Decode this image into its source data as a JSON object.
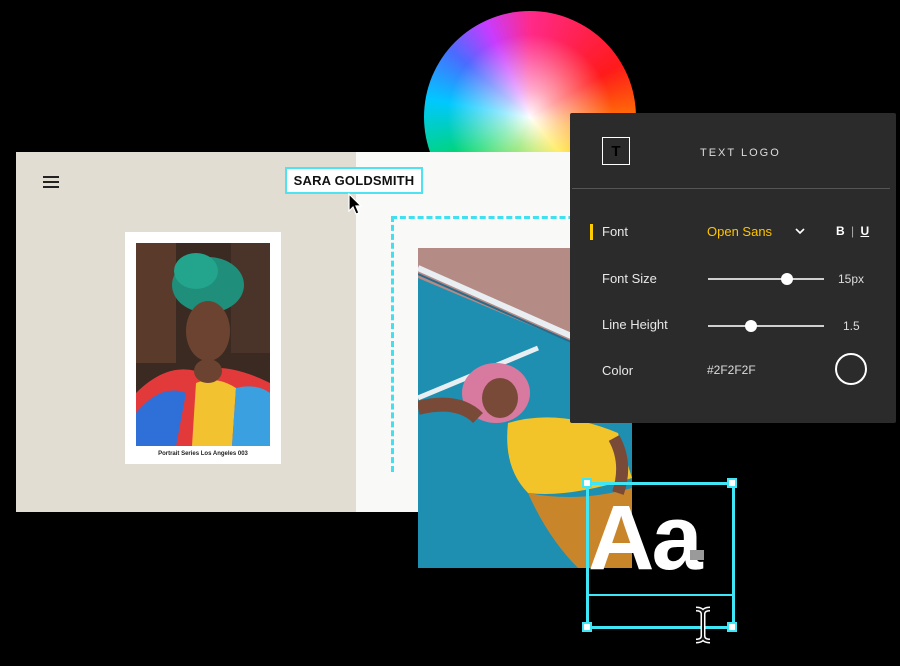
{
  "site": {
    "title": "SARA GOLDSMITH",
    "caption": "Portrait Series Los Angeles 003"
  },
  "panel": {
    "header": "TEXT LOGO",
    "icon_letter": "T",
    "font_label": "Font",
    "font_value": "Open Sans",
    "style_buttons": "B | U",
    "font_size_label": "Font Size",
    "font_size_value": "15px",
    "font_size_level": 0.68,
    "line_height_label": "Line Height",
    "line_height_value": "1.5",
    "line_height_level": 0.37,
    "color_label": "Color",
    "color_value": "#2F2F2F"
  },
  "sample_text": "Aa",
  "colors": {
    "accent_cyan": "#3fe6f5",
    "panel_bg": "#2b2b2b",
    "font_highlight": "#ffc400",
    "site_left_bg": "#e2ddd3"
  },
  "icons": [
    "hamburger-menu-icon",
    "arrow-cursor-icon",
    "text-t-icon",
    "chevron-down-icon",
    "i-beam-cursor-icon",
    "color-wheel"
  ]
}
